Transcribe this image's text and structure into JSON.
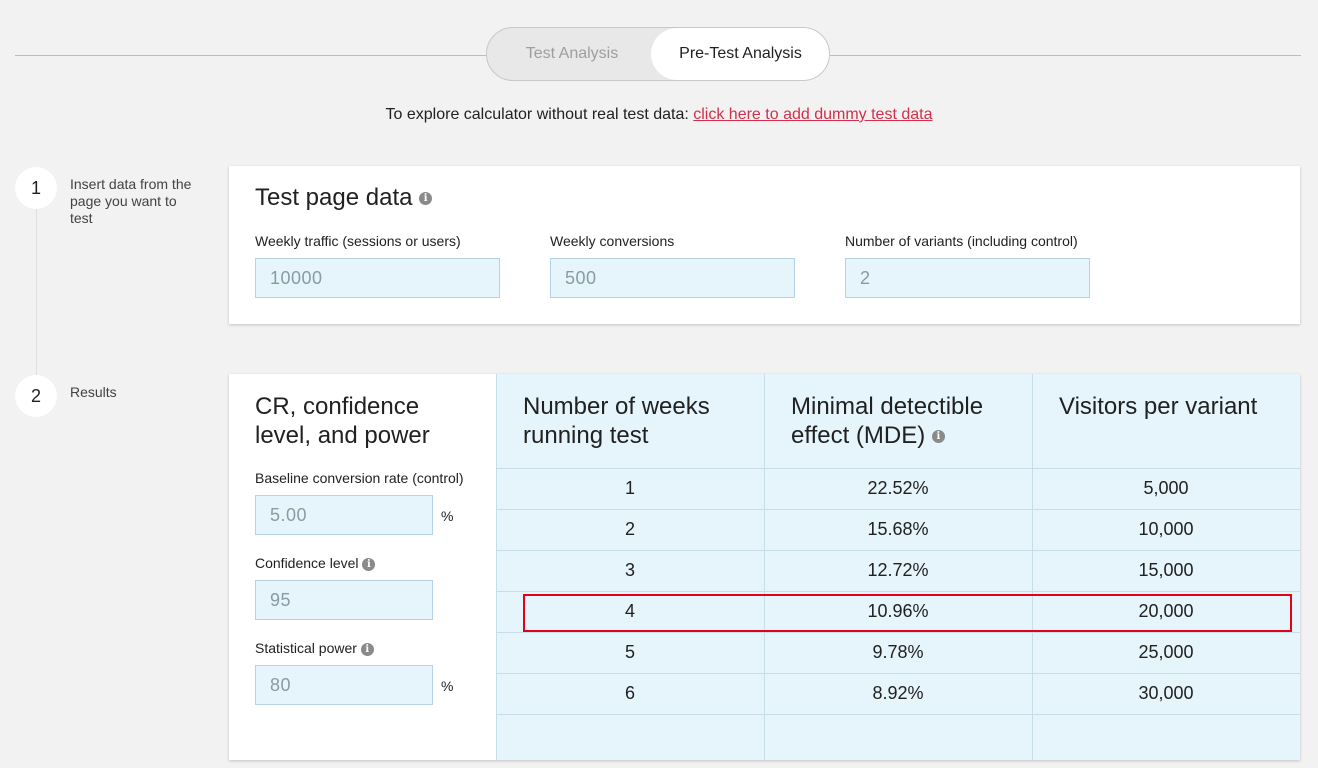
{
  "tabs": {
    "test_analysis": "Test Analysis",
    "pre_test_analysis": "Pre-Test Analysis"
  },
  "dummy": {
    "prefix": "To explore calculator without real test data:",
    "link": "click here to add dummy test data"
  },
  "steps": [
    {
      "number": "1",
      "text": "Insert data from the page you want to test"
    },
    {
      "number": "2",
      "text": "Results"
    }
  ],
  "test_page": {
    "title": "Test page data",
    "fields": [
      {
        "label": "Weekly traffic (sessions or users)",
        "value": "10000"
      },
      {
        "label": "Weekly conversions",
        "value": "500"
      },
      {
        "label": "Number of variants (including control)",
        "value": "2"
      }
    ]
  },
  "settings": {
    "title": "CR, confidence level, and power",
    "baseline": {
      "label": "Baseline conversion rate (control)",
      "value": "5.00",
      "unit": "%"
    },
    "confidence": {
      "label": "Confidence level",
      "value": "95"
    },
    "power": {
      "label": "Statistical power",
      "value": "80",
      "unit": "%"
    }
  },
  "results": {
    "headers": [
      "Number of weeks running test",
      "Minimal detectible effect (MDE)",
      "Visitors per variant"
    ],
    "rows": [
      [
        "1",
        "22.52%",
        "5,000"
      ],
      [
        "2",
        "15.68%",
        "10,000"
      ],
      [
        "3",
        "12.72%",
        "15,000"
      ],
      [
        "4",
        "10.96%",
        "20,000"
      ],
      [
        "5",
        "9.78%",
        "25,000"
      ],
      [
        "6",
        "8.92%",
        "30,000"
      ]
    ],
    "highlighted_row": "4"
  },
  "colors": {
    "accent_link": "#d32f4a",
    "highlight_border": "#e3001b",
    "input_bg": "#e6f5fc"
  }
}
